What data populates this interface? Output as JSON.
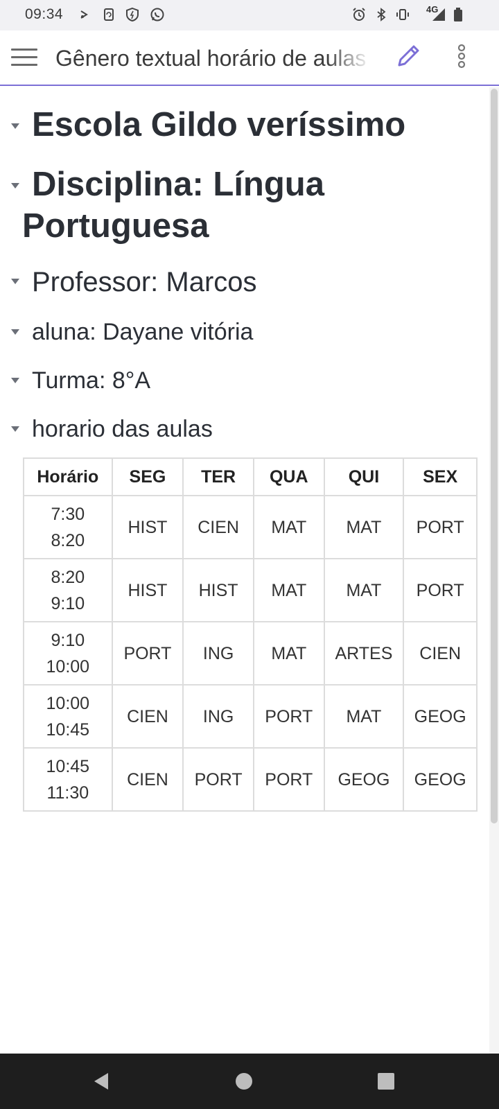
{
  "status_bar": {
    "time": "09:34",
    "network_type": "4G",
    "left_icons": [
      "media-icon",
      "screenshot-icon",
      "shield-icon",
      "whatsapp-icon"
    ],
    "right_icons": [
      "alarm-icon",
      "bluetooth-icon",
      "vibrate-icon",
      "signal-icon",
      "battery-icon"
    ]
  },
  "app_bar": {
    "title": "Gênero textual horário de aulas",
    "accent_color": "#7c6fd6"
  },
  "document": {
    "headings": [
      "Escola Gildo veríssimo",
      "Disciplina: Língua Portuguesa",
      "Professor: Marcos",
      "aluna: Dayane vitória",
      "Turma: 8°A",
      "horario das aulas"
    ],
    "schedule": {
      "headers": [
        "Horário",
        "SEG",
        "TER",
        "QUA",
        "QUI",
        "SEX"
      ],
      "rows": [
        {
          "time_start": "7:30",
          "time_end": "8:20",
          "cells": [
            "HIST",
            "CIEN",
            "MAT",
            "MAT",
            "PORT"
          ]
        },
        {
          "time_start": "8:20",
          "time_end": "9:10",
          "cells": [
            "HIST",
            "HIST",
            "MAT",
            "MAT",
            "PORT"
          ]
        },
        {
          "time_start": "9:10",
          "time_end": "10:00",
          "cells": [
            "PORT",
            "ING",
            "MAT",
            "ARTES",
            "CIEN"
          ]
        },
        {
          "time_start": "10:00",
          "time_end": "10:45",
          "cells": [
            "CIEN",
            "ING",
            "PORT",
            "MAT",
            "GEOG"
          ]
        },
        {
          "time_start": "10:45",
          "time_end": "11:30",
          "cells": [
            "CIEN",
            "PORT",
            "PORT",
            "GEOG",
            "GEOG"
          ]
        }
      ]
    }
  },
  "nav_bar": {
    "buttons": [
      "back-icon",
      "home-icon",
      "recents-icon"
    ]
  }
}
